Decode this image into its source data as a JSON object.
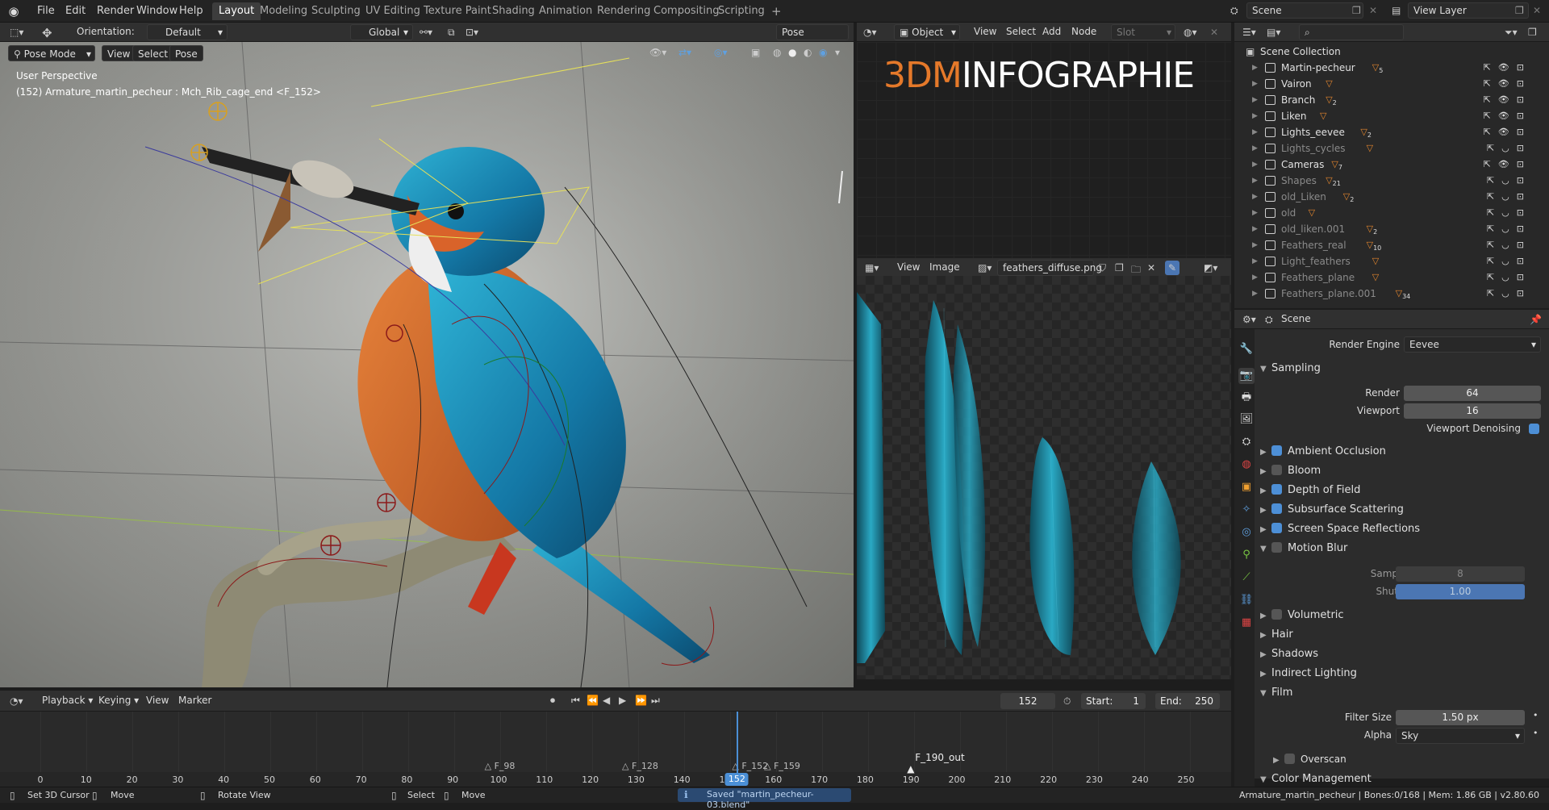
{
  "menu": [
    "File",
    "Edit",
    "Render",
    "Window",
    "Help"
  ],
  "workspace_tabs": [
    "Layout",
    "Modeling",
    "Sculpting",
    "UV Editing",
    "Texture Paint",
    "Shading",
    "Animation",
    "Rendering",
    "Compositing",
    "Scripting"
  ],
  "active_tab": "Layout",
  "add_tab": "+",
  "scene_name": "Scene",
  "view_layer": "View Layer",
  "viewport": {
    "orientation_label": "Orientation:",
    "orientation": "Default",
    "transform": "Global",
    "pose_options": "Pose Options",
    "mode": "Pose Mode",
    "menus": [
      "View",
      "Select",
      "Pose"
    ],
    "info_line1": "User Perspective",
    "info_line2": "(152) Armature_martin_pecheur : Mch_Rib_cage_end <F_152>"
  },
  "node_editor": {
    "mode": "Object",
    "menus": [
      "View",
      "Select",
      "Add",
      "Node"
    ],
    "slot": "Slot",
    "logo_prefix": "3DM",
    "logo_rest": "INFOGRAPHIE",
    "logo_accent": "#e5792a"
  },
  "image_editor": {
    "menus": [
      "View",
      "Image"
    ],
    "image_name": "feathers_diffuse.png"
  },
  "outliner": {
    "root": "Scene Collection",
    "items": [
      {
        "label": "Martin-pecheur",
        "badge": "5",
        "dim": false
      },
      {
        "label": "Vairon",
        "badge": "",
        "dim": false
      },
      {
        "label": "Branch",
        "badge": "2",
        "dim": false
      },
      {
        "label": "Liken",
        "badge": "",
        "dim": false
      },
      {
        "label": "Lights_eevee",
        "badge": "2",
        "dim": false
      },
      {
        "label": "Lights_cycles",
        "badge": "",
        "dim": true
      },
      {
        "label": "Cameras",
        "badge": "7",
        "dim": false
      },
      {
        "label": "Shapes",
        "badge": "21",
        "dim": true
      },
      {
        "label": "old_Liken",
        "badge": "2",
        "dim": true
      },
      {
        "label": "old",
        "badge": "",
        "dim": true
      },
      {
        "label": "old_liken.001",
        "badge": "2",
        "dim": true
      },
      {
        "label": "Feathers_real",
        "badge": "10",
        "dim": true
      },
      {
        "label": "Light_feathers",
        "badge": "",
        "dim": true
      },
      {
        "label": "Feathers_plane",
        "badge": "",
        "dim": true
      },
      {
        "label": "Feathers_plane.001",
        "badge": "34",
        "dim": true
      }
    ]
  },
  "properties": {
    "context": "Scene",
    "render_engine_label": "Render Engine",
    "render_engine": "Eevee",
    "sampling": "Sampling",
    "render_label": "Render",
    "render_value": "64",
    "viewport_label": "Viewport",
    "viewport_value": "16",
    "viewport_denoising": "Viewport Denoising",
    "panels": [
      {
        "label": "Ambient Occlusion",
        "checked": true
      },
      {
        "label": "Bloom",
        "checked": false
      },
      {
        "label": "Depth of Field",
        "checked": true
      },
      {
        "label": "Subsurface Scattering",
        "checked": true
      },
      {
        "label": "Screen Space Reflections",
        "checked": true
      },
      {
        "label": "Motion Blur",
        "checked": false
      }
    ],
    "samples_label": "Samples",
    "samples_value": "8",
    "shutter_label": "Shutter",
    "shutter_value": "1.00",
    "volumetric": "Volumetric",
    "sections": [
      "Hair",
      "Shadows",
      "Indirect Lighting"
    ],
    "film": "Film",
    "filter_size_label": "Filter Size",
    "filter_size": "1.50 px",
    "alpha_label": "Alpha",
    "alpha": "Sky",
    "overscan": "Overscan",
    "color_management": "Color Management"
  },
  "timeline": {
    "menus": [
      "Playback",
      "Keying",
      "View",
      "Marker"
    ],
    "current_frame": "152",
    "start_label": "Start:",
    "start": "1",
    "end_label": "End:",
    "end": "250",
    "ticks": [
      "0",
      "10",
      "20",
      "30",
      "40",
      "50",
      "60",
      "70",
      "80",
      "90",
      "100",
      "110",
      "120",
      "130",
      "140",
      "150",
      "160",
      "170",
      "180",
      "190",
      "200",
      "210",
      "220",
      "230",
      "240",
      "250"
    ],
    "markers": [
      {
        "frame": 98,
        "label": "F_98"
      },
      {
        "frame": 128,
        "label": "F_128"
      },
      {
        "frame": 152,
        "label": "F_152"
      },
      {
        "frame": 159,
        "label": "F_159"
      }
    ],
    "marker_out": "F_190_out",
    "marker_out_frame": 190
  },
  "statusbar": {
    "items": [
      "Set 3D Cursor",
      "Move",
      "Rotate View",
      "Select",
      "Move"
    ],
    "saved": "Saved \"martin_pecheur-03.blend\"",
    "info": "Armature_martin_pecheur | Bones:0/168 | Mem: 1.86 GB | v2.80.60"
  }
}
